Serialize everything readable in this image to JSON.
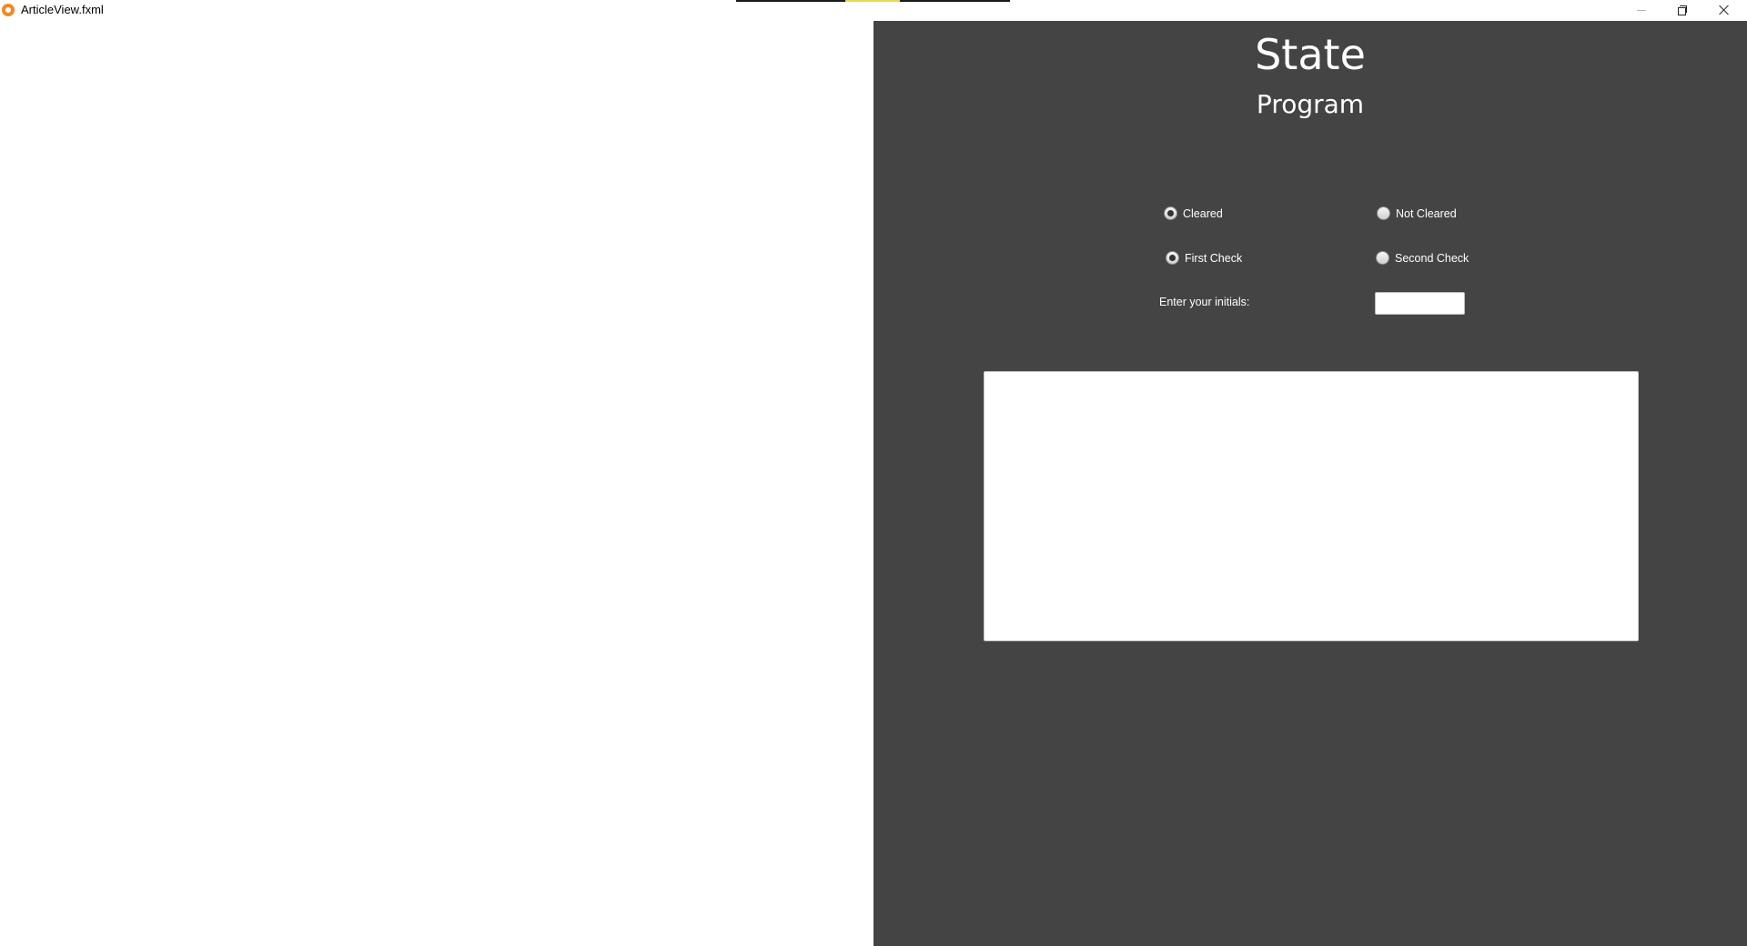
{
  "window": {
    "title": "ArticleView.fxml",
    "icon": "app-logo-icon",
    "controls": {
      "minimize_icon": "minimize-icon",
      "maximize_icon": "restore-icon",
      "close_icon": "close-icon"
    }
  },
  "header": {
    "title": "State",
    "subtitle": "Program"
  },
  "form": {
    "clearance_group": {
      "options": [
        {
          "label": "Cleared",
          "selected": true
        },
        {
          "label": "Not Cleared",
          "selected": false
        }
      ]
    },
    "check_group": {
      "options": [
        {
          "label": "First Check",
          "selected": true
        },
        {
          "label": "Second Check",
          "selected": false
        }
      ]
    },
    "initials": {
      "label": "Enter your initials:",
      "value": "",
      "placeholder": ""
    },
    "notes": {
      "value": "",
      "placeholder": ""
    }
  },
  "colors": {
    "panel_background": "#444444",
    "content_background": "#ffffff",
    "text_on_panel": "#ffffff",
    "app_icon": "#f08a24"
  }
}
